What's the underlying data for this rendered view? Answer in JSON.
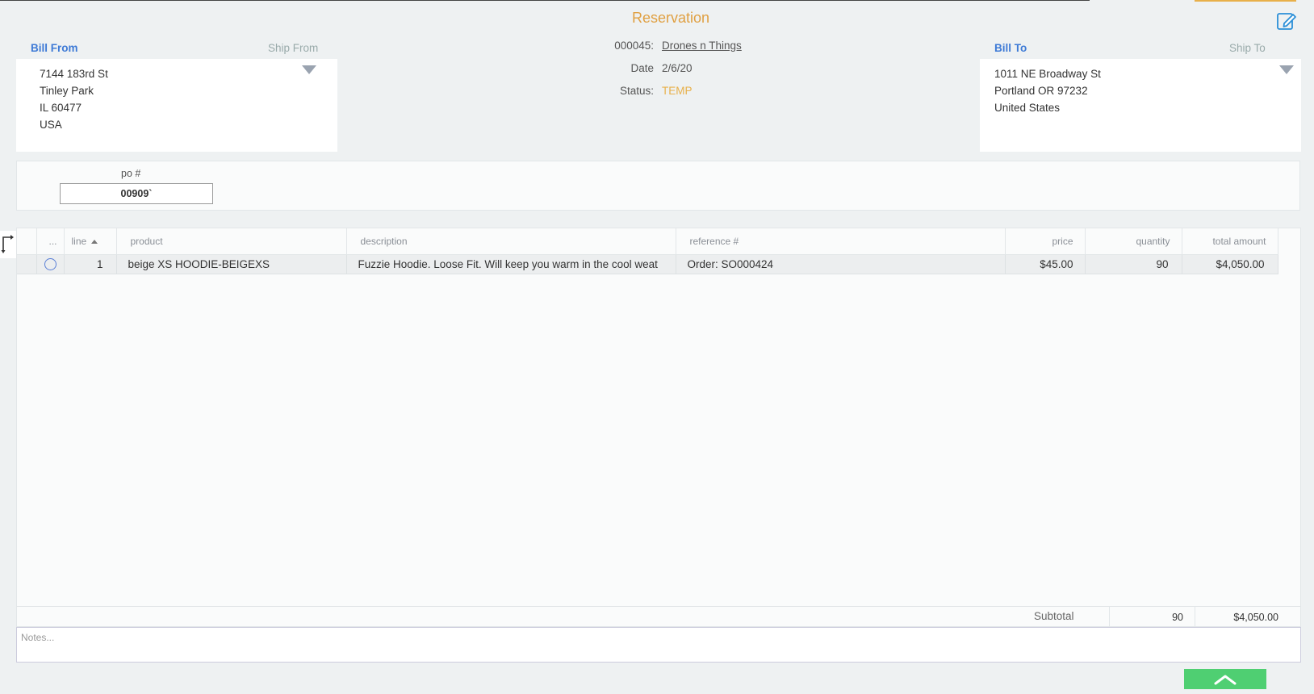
{
  "header": {
    "title": "Reservation",
    "id_label": "000045:",
    "company": "Drones n Things",
    "date_label": "Date",
    "date_value": "2/6/20",
    "status_label": "Status:",
    "status_value": "TEMP"
  },
  "bill_from": {
    "bill_label": "Bill From",
    "ship_label": "Ship From",
    "lines": [
      "7144 183rd St",
      "Tinley Park",
      "IL 60477",
      "USA"
    ]
  },
  "bill_to": {
    "bill_label": "Bill To",
    "ship_label": "Ship To",
    "lines": [
      "1011 NE Broadway St",
      "Portland OR 97232",
      "United States"
    ]
  },
  "po": {
    "label": "po #",
    "value": "00909`"
  },
  "grid": {
    "columns": {
      "menu": "...",
      "line": "line",
      "product": "product",
      "description": "description",
      "reference": "reference #",
      "price": "price",
      "quantity": "quantity",
      "total": "total amount"
    },
    "rows": [
      {
        "line": "1",
        "product": "beige XS HOODIE-BEIGEXS",
        "description": "Fuzzie Hoodie. Loose Fit. Will keep you warm in the cool weat",
        "reference": "Order: SO000424",
        "price": "$45.00",
        "quantity": "90",
        "total": "$4,050.00"
      }
    ]
  },
  "subtotal": {
    "label": "Subtotal",
    "quantity": "90",
    "amount": "$4,050.00"
  },
  "notes": {
    "placeholder": "Notes..."
  },
  "colors": {
    "accent": "#e0a042",
    "link_blue": "#3d7ad6",
    "collapse_green": "#4fcf72"
  }
}
